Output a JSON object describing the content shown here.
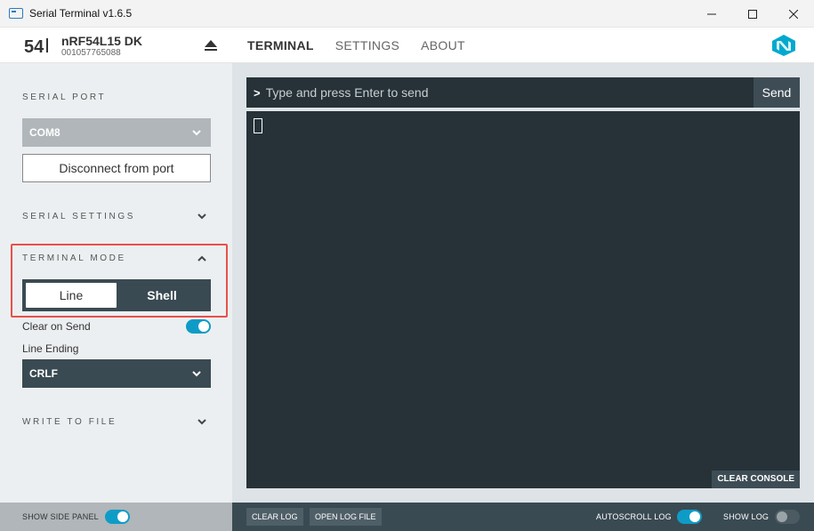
{
  "window": {
    "title": "Serial Terminal v1.6.5"
  },
  "device": {
    "name": "nRF54L15 DK",
    "serial": "001057765088",
    "logo_text": "54"
  },
  "nav": {
    "tabs": [
      {
        "label": "TERMINAL",
        "active": true
      },
      {
        "label": "SETTINGS",
        "active": false
      },
      {
        "label": "ABOUT",
        "active": false
      }
    ]
  },
  "sidebar": {
    "serial_port": {
      "title": "SERIAL PORT",
      "port_value": "COM8",
      "disconnect_label": "Disconnect from port"
    },
    "serial_settings": {
      "title": "SERIAL SETTINGS"
    },
    "terminal_mode": {
      "title": "TERMINAL MODE",
      "options": [
        "Line",
        "Shell"
      ],
      "selected": "Line",
      "clear_on_send_label": "Clear on Send",
      "clear_on_send": true,
      "line_ending_label": "Line Ending",
      "line_ending_value": "CRLF"
    },
    "write_to_file": {
      "title": "WRITE TO FILE"
    }
  },
  "terminal": {
    "prompt": ">",
    "input_placeholder": "Type and press Enter to send",
    "send_label": "Send",
    "clear_console_label": "CLEAR CONSOLE"
  },
  "bottom_bar": {
    "show_side_panel_label": "SHOW SIDE PANEL",
    "show_side_panel": true,
    "clear_log_label": "CLEAR LOG",
    "open_log_file_label": "OPEN LOG FILE",
    "autoscroll_label": "AUTOSCROLL LOG",
    "autoscroll": true,
    "show_log_label": "SHOW LOG",
    "show_log": false
  },
  "colors": {
    "accent": "#0e9cc7",
    "terminal_bg": "#263238",
    "highlight_border": "#e8504a",
    "nordic_blue": "#00a9ce"
  }
}
